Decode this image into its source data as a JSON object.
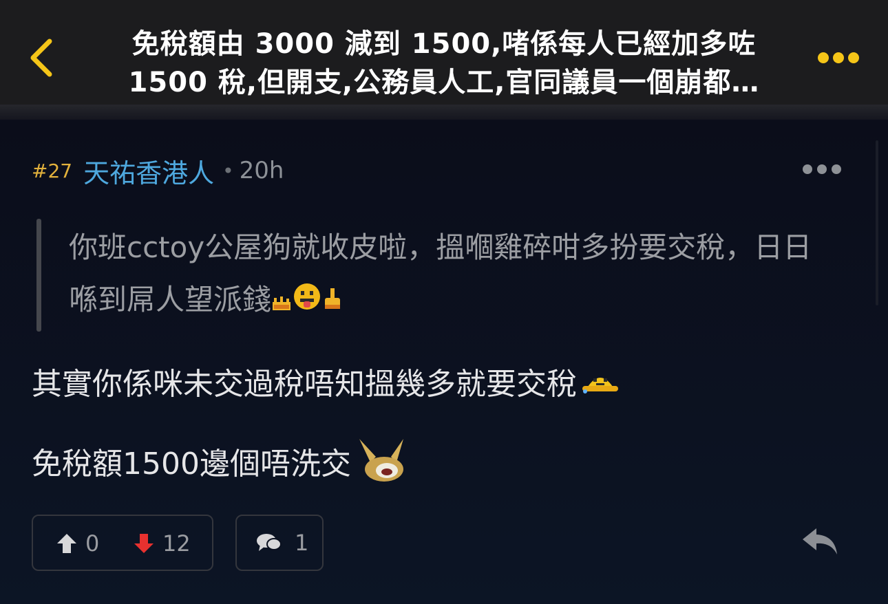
{
  "header": {
    "title_line_1": "免稅額由 3000 減到 1500,啫係每人已經加多咗",
    "title_line_2": "1500 稅,但開支,公務員人工,官同議員一個崩都…",
    "back_icon": "chevron-left-icon",
    "more_icon": "more-horizontal-icon",
    "accent_color": "#f5c518"
  },
  "post": {
    "floor": "#27",
    "username": "天祐香港人",
    "separator": "•",
    "time": "20h",
    "quote": "你班cctoy公屋狗就收皮啦，搵嗰雞碎咁多扮要交稅，日日喺到屌人望派錢",
    "quote_emojis": [
      "fire-emoji-icon",
      "tongue-face-emoji-icon",
      "middle-finger-emoji-icon"
    ],
    "body_line_1": "其實你係咪未交過稅唔知搵幾多就要交稅",
    "body_line_1_emoji": "sweat-face-emoji-icon",
    "body_line_2": "免稅額1500邊個唔洗交",
    "body_line_2_emoji": "rabbit-laugh-emoji-icon",
    "username_color": "#4ea8de",
    "floor_color": "#e2b13c"
  },
  "actions": {
    "upvotes": "0",
    "downvotes": "12",
    "comments": "1",
    "upvote_icon": "arrow-up-icon",
    "downvote_icon": "arrow-down-icon",
    "comment_icon": "speech-bubbles-icon",
    "reply_icon": "reply-arrow-icon",
    "downvote_color": "#e8312f"
  }
}
